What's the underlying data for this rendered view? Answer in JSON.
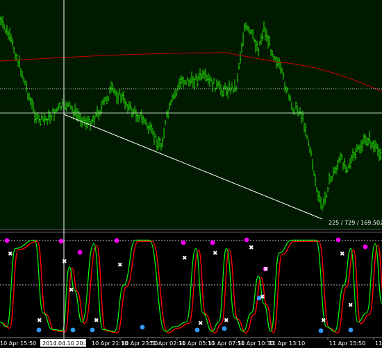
{
  "colors": {
    "background": "#000000",
    "price_panel": "#001a00",
    "candles": "#22dd00",
    "ma_line": "#cc0000",
    "hline": "#b8d8b8",
    "trendline": "#ffffff",
    "crosshair": "#ffffff",
    "osc_main": "#00ff00",
    "osc_signal": "#ff0000",
    "osc_level": "#bbbbbb",
    "marker_top": "#ff00ff",
    "marker_bottom": "#3399ff"
  },
  "price_panel": {
    "measure_label": "225 / 729 / 169.502"
  },
  "time_axis": {
    "labels": [
      "10 Apr 15:50",
      "10 Apr 21:10",
      "10 Apr 23:50",
      "11 Apr 02:30",
      "11 Apr 05:10",
      "11 Apr 07:50",
      "11 Apr 10:30",
      "11 Apr 13:10",
      "11 Apr 15:50",
      "11 Ap"
    ],
    "crosshair_stamp": "2014.04.10 20:20"
  },
  "oscillator": {
    "levels_shown": [
      "upper",
      "lower"
    ]
  }
}
